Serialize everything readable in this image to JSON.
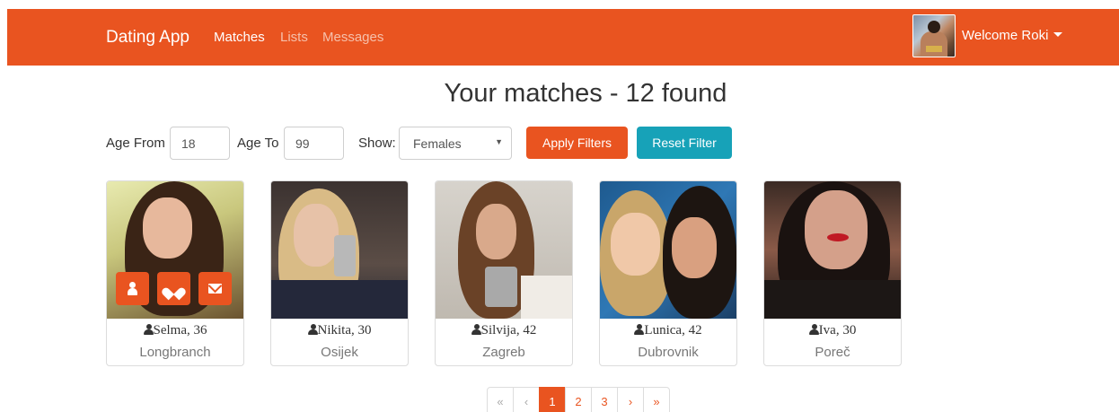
{
  "navbar": {
    "brand": "Dating App",
    "links": [
      {
        "label": "Matches",
        "active": true
      },
      {
        "label": "Lists",
        "active": false
      },
      {
        "label": "Messages",
        "active": false
      }
    ],
    "welcome": "Welcome Roki"
  },
  "title": "Your matches - 12 found",
  "filters": {
    "age_from_label": "Age From",
    "age_from_value": "18",
    "age_to_label": "Age To",
    "age_to_value": "99",
    "show_label": "Show:",
    "show_value": "Females",
    "apply_label": "Apply Filters",
    "reset_label": "Reset Filter"
  },
  "members": [
    {
      "name": "Selma, 36",
      "city": "Longbranch"
    },
    {
      "name": "Nikita, 30",
      "city": "Osijek"
    },
    {
      "name": "Silvija, 42",
      "city": "Zagreb"
    },
    {
      "name": "Lunica, 42",
      "city": "Dubrovnik"
    },
    {
      "name": "Iva, 30",
      "city": "Poreč"
    }
  ],
  "pagination": {
    "first": "«",
    "prev": "‹",
    "pages": [
      "1",
      "2",
      "3"
    ],
    "next": "›",
    "last": "»",
    "current_page": 1
  },
  "colors": {
    "primary": "#E95420",
    "info": "#17a2b8"
  }
}
